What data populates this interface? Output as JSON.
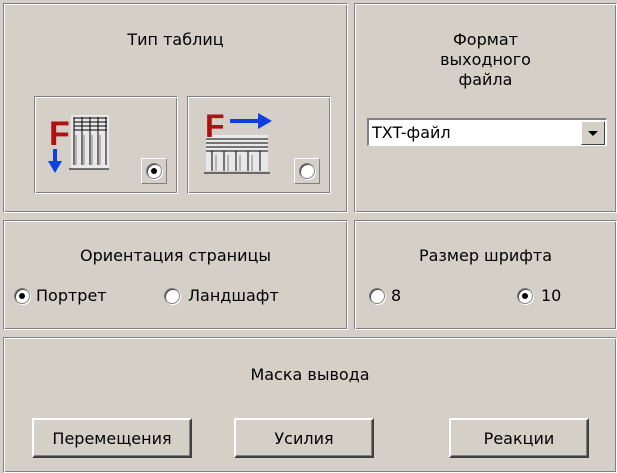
{
  "table_type": {
    "title": "Тип таблиц",
    "options": [
      {
        "icon": "table-vertical-icon",
        "selected": true
      },
      {
        "icon": "table-horizontal-icon",
        "selected": false
      }
    ]
  },
  "output_format": {
    "title_lines": [
      "Формат",
      "выходного",
      "файла"
    ],
    "selected": "TXT-файл"
  },
  "orientation": {
    "title": "Ориентация страницы",
    "options": [
      {
        "label": "Портрет",
        "selected": true
      },
      {
        "label": "Ландшафт",
        "selected": false
      }
    ]
  },
  "font_size": {
    "title": "Размер шрифта",
    "options": [
      {
        "label": "8",
        "selected": false
      },
      {
        "label": "10",
        "selected": true
      }
    ]
  },
  "output_mask": {
    "title": "Маска вывода",
    "buttons": [
      "Перемещения",
      "Усилия",
      "Реакции"
    ]
  },
  "colors": {
    "face": "#d4d0c8",
    "icon_red": "#b01010",
    "icon_blue": "#1040e0"
  }
}
